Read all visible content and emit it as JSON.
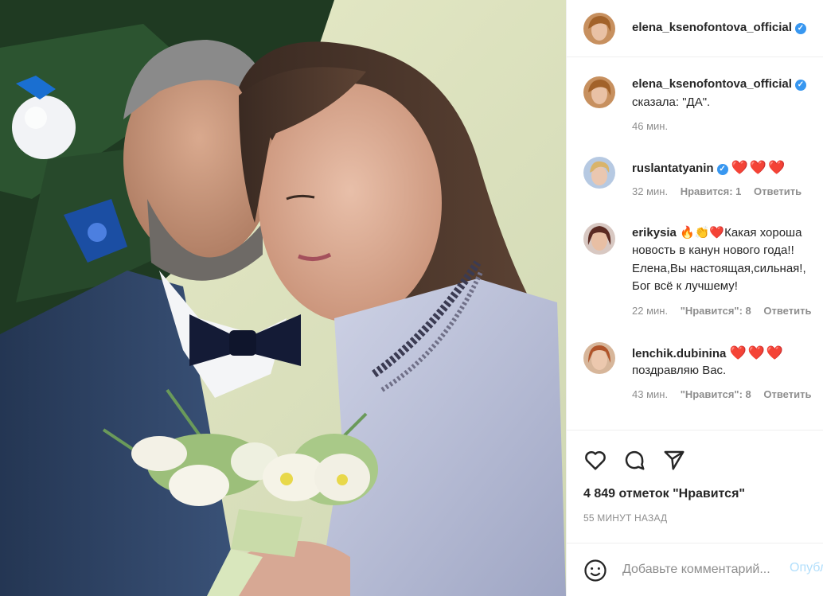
{
  "post": {
    "author": "elena_ksenofontova_official"
  },
  "caption": {
    "username": "elena_ksenofontova_official",
    "text": "сказала: \"ДА\".",
    "time": "46 мин."
  },
  "comments": [
    {
      "username": "ruslantatyanin",
      "hearts": "❤️❤️❤️",
      "time": "32 мин.",
      "likes": "Нравится: 1",
      "reply": "Ответить"
    },
    {
      "username": "erikysia",
      "emoji": "🔥👏❤️",
      "line1": "Какая хороша",
      "line2": "новость в канун нового года!!",
      "line3": "Елена,Вы настоящая,сильная!,",
      "line4": "Бог всё к лучшему!",
      "time": "22 мин.",
      "likes": "\"Нравится\": 8",
      "reply": "Ответить"
    },
    {
      "username": "lenchik.dubinina",
      "hearts": "❤️❤️❤️",
      "text": "поздравляю Вас.",
      "time": "43 мин.",
      "likes": "\"Нравится\": 8",
      "reply": "Ответить"
    }
  ],
  "likes_summary": "4 849 отметок \"Нравится\"",
  "posted_ago": "55 МИНУТ НАЗАД",
  "comment_box": {
    "placeholder": "Добавьте комментарий...",
    "post_label": "Опубликовать"
  },
  "icons": {
    "verified": "verified-badge-icon",
    "like": "heart-icon",
    "comment": "comment-icon",
    "share": "send-icon",
    "emoji": "smiley-icon"
  },
  "colors": {
    "verified": "#3897f0",
    "heart": "#e0122f",
    "post_button": "#b2dffc"
  }
}
